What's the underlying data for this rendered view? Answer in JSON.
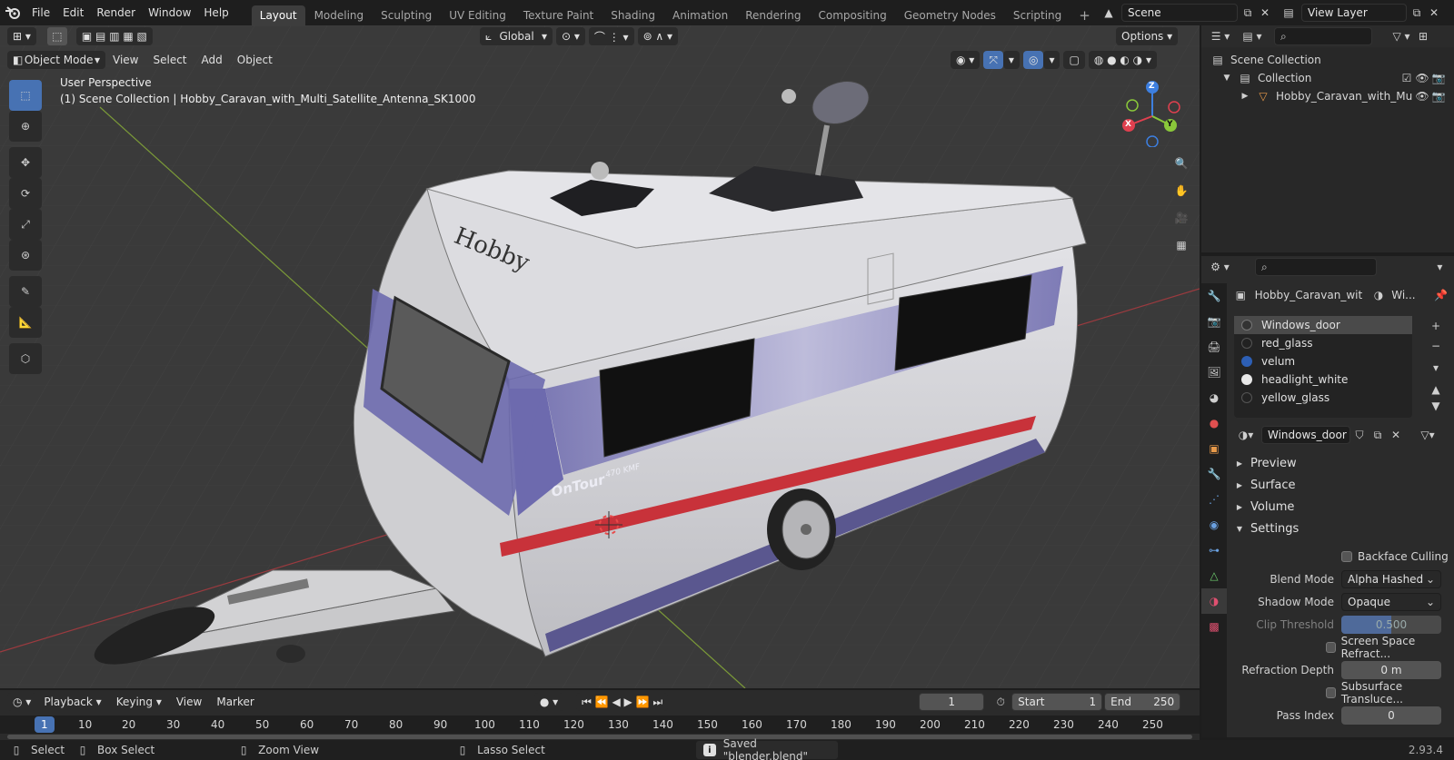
{
  "app": {
    "menus": [
      "File",
      "Edit",
      "Render",
      "Window",
      "Help"
    ],
    "workspaces": [
      "Layout",
      "Modeling",
      "Sculpting",
      "UV Editing",
      "Texture Paint",
      "Shading",
      "Animation",
      "Rendering",
      "Compositing",
      "Geometry Nodes",
      "Scripting"
    ],
    "active_workspace": "Layout",
    "scene_name": "Scene",
    "view_layer": "View Layer"
  },
  "viewport": {
    "mode": "Object Mode",
    "header_menus": [
      "View",
      "Select",
      "Add",
      "Object"
    ],
    "transform_orientation": "Global",
    "options_label": "Options",
    "overlay_title": "User Perspective",
    "overlay_subtitle": "(1) Scene Collection | Hobby_Caravan_with_Multi_Satellite_Antenna_SK1000",
    "gizmo_axes": {
      "x": "X",
      "y": "Y",
      "z": "Z"
    },
    "model_text": {
      "brand": "Hobby",
      "model": "OnTour",
      "model_sub": "470 KMF"
    }
  },
  "outliner": {
    "search_placeholder": "",
    "root": "Scene Collection",
    "collection": "Collection",
    "object": "Hobby_Caravan_with_Mu"
  },
  "properties": {
    "object_name": "Hobby_Caravan_wit...",
    "material_short": "Wi...",
    "materials": [
      "Windows_door",
      "red_glass",
      "velum",
      "headlight_white",
      "yellow_glass"
    ],
    "active_material": "Windows_door",
    "sections": [
      "Preview",
      "Surface",
      "Volume",
      "Settings"
    ],
    "settings": {
      "backface_culling": "Backface Culling",
      "blend_mode_label": "Blend Mode",
      "blend_mode": "Alpha Hashed",
      "shadow_mode_label": "Shadow Mode",
      "shadow_mode": "Opaque",
      "clip_threshold_label": "Clip Threshold",
      "clip_threshold": "0.500",
      "ssr": "Screen Space Refract...",
      "refraction_depth_label": "Refraction Depth",
      "refraction_depth": "0 m",
      "sss": "Subsurface Transluce...",
      "pass_index_label": "Pass Index",
      "pass_index": "0"
    }
  },
  "timeline": {
    "menus": [
      "Playback",
      "Keying",
      "View",
      "Marker"
    ],
    "current_frame": "1",
    "start_label": "Start",
    "start": "1",
    "end_label": "End",
    "end": "250",
    "ruler": [
      "1",
      "10",
      "20",
      "30",
      "40",
      "50",
      "60",
      "70",
      "80",
      "90",
      "100",
      "110",
      "120",
      "130",
      "140",
      "150",
      "160",
      "170",
      "180",
      "190",
      "200",
      "210",
      "220",
      "230",
      "240",
      "250"
    ]
  },
  "status": {
    "select": "Select",
    "box_select": "Box Select",
    "zoom_view": "Zoom View",
    "lasso_select": "Lasso Select",
    "message": "Saved \"blender.blend\"",
    "version": "2.93.4"
  },
  "colors": {
    "accent": "#4772b3",
    "caravan_body": "#d2d2d6",
    "caravan_stripe": "#6e6ab0",
    "axis_x": "#e0404f",
    "axis_y": "#8ac83a",
    "axis_z": "#3d7fe0"
  }
}
